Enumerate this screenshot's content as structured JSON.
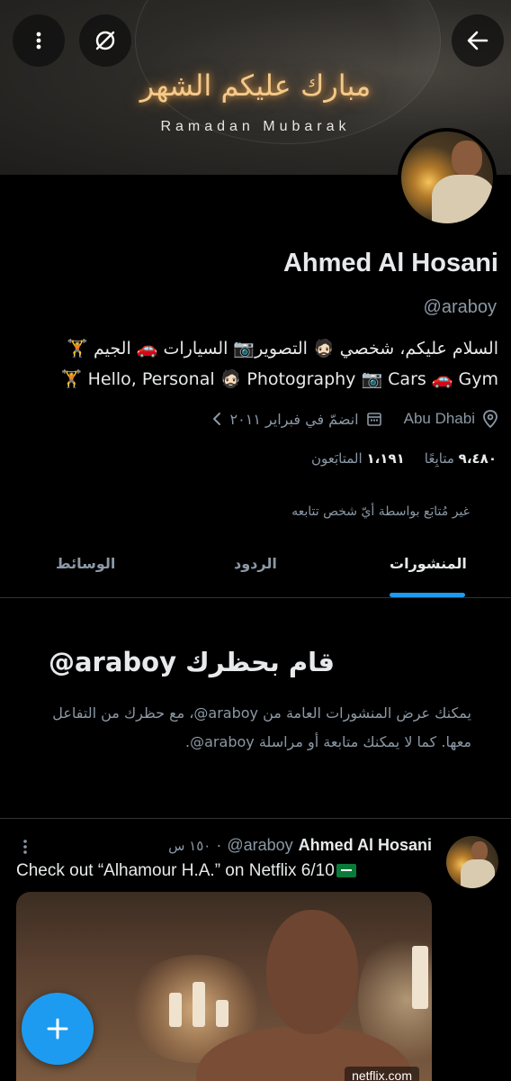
{
  "banner": {
    "arabic_text": "مبارك عليكم الشهر",
    "english_text": "Ramadan Mubarak"
  },
  "profile": {
    "name": "Ahmed Al Hosani",
    "handle": "@araboy",
    "bio_ar": "السلام عليكم، شخصي 🧔🏻 التصوير📷 السيارات 🚗 الجيم 🏋️",
    "bio_en": "🏋️ Hello, Personal 🧔🏻 Photography 📷 Cars 🚗 Gym",
    "location": "Abu Dhabi",
    "joined": "انضمّ في فبراير ٢٠١١",
    "followers_count": "١،١٩١",
    "followers_label": "المتابَعون",
    "following_count": "٩،٤٨٠",
    "following_label": "متابِعًا",
    "follow_note": "غير مُتابَع بواسطة أيّ شخص تتابعه"
  },
  "tabs": {
    "posts": "المنشورات",
    "replies": "الردود",
    "media": "الوسائط",
    "active": "posts"
  },
  "blocked": {
    "title": "قام بحظرك araboy@",
    "body": "يمكنك عرض المنشورات العامة من araboy@، مع حظرك من التفاعل معها. كما لا يمكنك متابعة أو مراسلة araboy@."
  },
  "tweet": {
    "author_name": "Ahmed Al Hosani",
    "author_handle": "@araboy",
    "time": "١٥٠ س",
    "text": "Check out “Alhamour H.A.” on Netflix 6/10",
    "media_watermark": "netflix.com"
  },
  "colors": {
    "accent": "#1d9bf0",
    "background": "#000000",
    "secondary_text": "#8b98a5",
    "banner_gold": "#f4c98a"
  },
  "icons": {
    "back": "arrow-left-icon",
    "more": "more-vertical-icon",
    "mute": "mute-slash-icon",
    "location": "location-pin-icon",
    "calendar": "calendar-icon",
    "chevron": "chevron-left-icon",
    "compose": "plus-icon"
  }
}
